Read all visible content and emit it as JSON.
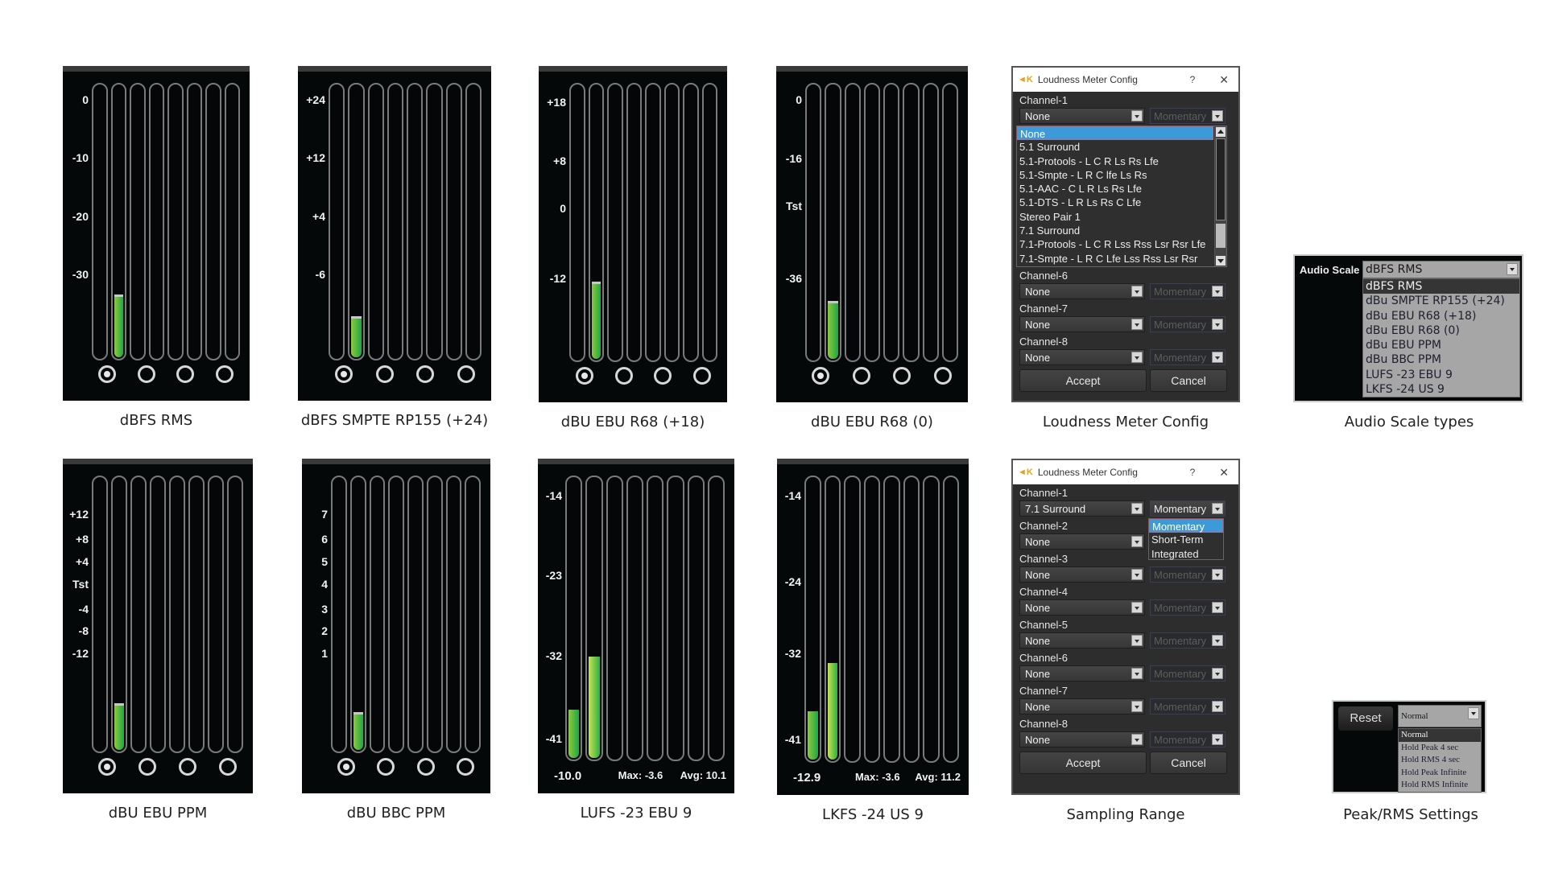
{
  "meters": [
    {
      "id": "dbfs-rms",
      "caption": "dBFS RMS",
      "ticks": [
        "0",
        "-10",
        "-20",
        "-30"
      ],
      "levels": [
        null,
        0.22
      ],
      "radios": 4,
      "radio_selected": 0
    },
    {
      "id": "dbfs-smpte",
      "caption": "dBFS SMPTE RP155 (+24)",
      "ticks": [
        "+24",
        "+12",
        "+4",
        "-6"
      ],
      "levels": [
        null,
        0.14
      ],
      "radios": 4,
      "radio_selected": 0
    },
    {
      "id": "dbu-ebu-r68-18",
      "caption": "dBU EBU R68 (+18)",
      "ticks": [
        "+18",
        "+8",
        "0",
        "-12"
      ],
      "levels": [
        null,
        0.27
      ],
      "radios": 4,
      "radio_selected": 0
    },
    {
      "id": "dbu-ebu-r68-0",
      "caption": "dBU EBU R68 (0)",
      "ticks": [
        "0",
        "-16",
        "Tst",
        "-36"
      ],
      "levels": [
        null,
        0.2
      ],
      "radios": 4,
      "radio_selected": 0
    },
    {
      "id": "dbu-ebu-ppm",
      "caption": "dBU EBU PPM",
      "ticks": [
        "+12",
        "+8",
        "+4",
        "Tst",
        "-4",
        "-8",
        "-12"
      ],
      "levels": [
        null,
        0.16
      ],
      "radios": 4,
      "radio_selected": 0
    },
    {
      "id": "dbu-bbc-ppm",
      "caption": "dBU BBC PPM",
      "ticks": [
        "7",
        "6",
        "5",
        "4",
        "3",
        "2",
        "1"
      ],
      "levels": [
        null,
        0.13
      ],
      "radios": 4,
      "radio_selected": 0
    },
    {
      "id": "lufs",
      "caption": "LUFS -23 EBU 9",
      "ticks": [
        "-14",
        "-23",
        "-32",
        "-41"
      ],
      "levels": [
        0.17,
        0.36
      ],
      "readout": {
        "value": "-10.0",
        "max": "Max: -3.6",
        "avg": "Avg: 10.1"
      }
    },
    {
      "id": "lkfs",
      "caption": "LKFS -24 US 9",
      "ticks": [
        "-14",
        "-24",
        "-32",
        "-41"
      ],
      "levels": [
        0.17,
        0.34
      ],
      "readout": {
        "value": "-12.9",
        "max": "Max: -3.6",
        "avg": "Avg: 11.2"
      }
    }
  ],
  "config_dialog_1": {
    "title": "Loudness Meter Config",
    "help": "?",
    "close": "✕",
    "caption": "Loudness Meter Config",
    "channel1_label": "Channel-1",
    "channel1_value": "None",
    "mode_value": "Momentary",
    "layout_options": [
      "None",
      "5.1 Surround",
      "5.1-Protools - L C R Ls Rs Lfe",
      "5.1-Smpte - L R C lfe Ls Rs",
      "5.1-AAC - C L R Ls Rs Lfe",
      "5.1-DTS -  L R Ls Rs C Lfe",
      "Stereo Pair 1",
      "7.1 Surround",
      "7.1-Protools - L C R Lss Rss Lsr Rsr Lfe",
      "7.1-Smpte - L R C Lfe Lss Rss Lsr Rsr"
    ],
    "selected_option": "None",
    "channels": [
      {
        "label": "Channel-6",
        "value": "None",
        "mode": "Momentary"
      },
      {
        "label": "Channel-7",
        "value": "None",
        "mode": "Momentary"
      },
      {
        "label": "Channel-8",
        "value": "None",
        "mode": "Momentary"
      }
    ],
    "accept": "Accept",
    "cancel": "Cancel"
  },
  "config_dialog_2": {
    "title": "Loudness Meter Config",
    "help": "?",
    "close": "✕",
    "caption": "Sampling Range",
    "channels": [
      {
        "label": "Channel-1",
        "value": "7.1 Surround",
        "mode": "Momentary",
        "active": true
      },
      {
        "label": "Channel-2",
        "value": "None",
        "mode": "",
        "active": false
      },
      {
        "label": "Channel-3",
        "value": "None",
        "mode": "Momentary",
        "active": false
      },
      {
        "label": "Channel-4",
        "value": "None",
        "mode": "Momentary",
        "active": false
      },
      {
        "label": "Channel-5",
        "value": "None",
        "mode": "Momentary",
        "active": false
      },
      {
        "label": "Channel-6",
        "value": "None",
        "mode": "Momentary",
        "active": false
      },
      {
        "label": "Channel-7",
        "value": "None",
        "mode": "Momentary",
        "active": false
      },
      {
        "label": "Channel-8",
        "value": "None",
        "mode": "Momentary",
        "active": false
      }
    ],
    "mode_options": [
      "Momentary",
      "Short-Term",
      "Integrated"
    ],
    "selected_mode": "Momentary",
    "accept": "Accept",
    "cancel": "Cancel"
  },
  "audio_scale": {
    "label": "Audio Scale",
    "value": "dBFS RMS",
    "options": [
      "dBFS RMS",
      "dBu SMPTE RP155 (+24)",
      "dBu EBU R68 (+18)",
      "dBu EBU R68 (0)",
      "dBu EBU PPM",
      "dBu BBC PPM",
      "LUFS -23 EBU 9",
      "LKFS -24 US 9"
    ],
    "selected": "dBFS RMS",
    "caption": "Audio Scale types"
  },
  "peak_rms": {
    "reset": "Reset",
    "value": "Normal",
    "options": [
      "Normal",
      "Hold Peak 4 sec",
      "Hold RMS 4 sec",
      "Hold Peak Infinite",
      "Hold RMS Infinite"
    ],
    "selected": "Normal",
    "caption": "Peak/RMS Settings"
  }
}
